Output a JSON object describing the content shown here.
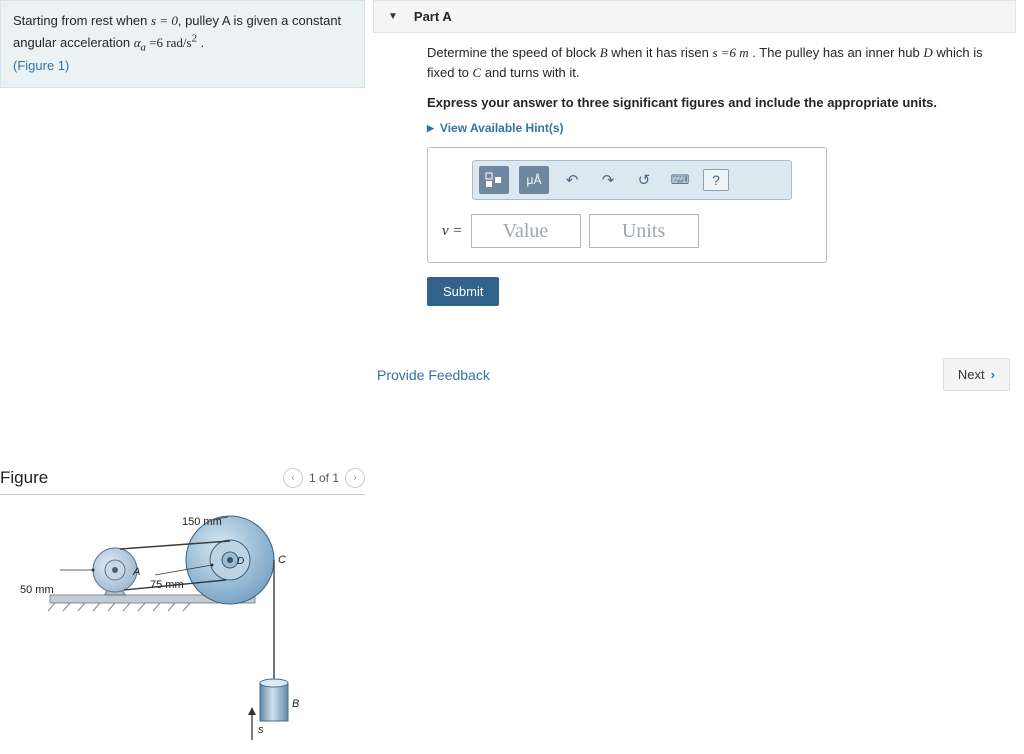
{
  "problem": {
    "text_prefix": "Starting from rest when ",
    "s_eq": "s = 0",
    "text_mid1": ", pulley A is given a constant angular acceleration ",
    "alpha_expr": "α",
    "alpha_sub": "a",
    "alpha_eq": " =6 rad/s",
    "alpha_sup": "2",
    "text_end": " .",
    "figure_link": "(Figure 1)"
  },
  "figure": {
    "heading": "Figure",
    "counter": "1 of 1",
    "labels": {
      "r_a": "50 mm",
      "A": "A",
      "r_d": "75 mm",
      "r_c": "150 mm",
      "D": "D",
      "C": "C",
      "B": "B",
      "s": "s"
    }
  },
  "part": {
    "title": "Part A",
    "instruction_1": "Determine the speed of block ",
    "B_i": "B",
    "instruction_2": " when it has risen ",
    "s_val": "s =6 m",
    "instruction_3": " . The pulley has an inner hub ",
    "D_i": "D",
    "instruction_4": " which is fixed to ",
    "C_i": "C",
    "instruction_5": " and turns with it.",
    "prompt": "Express your answer to three significant figures and include the appropriate units.",
    "hints": "View Available Hint(s)",
    "toolbar": {
      "units_btn": "μÅ",
      "help": "?"
    },
    "answer": {
      "label": "v =",
      "value_ph": "Value",
      "units_ph": "Units"
    },
    "submit": "Submit"
  },
  "footer": {
    "feedback": "Provide Feedback",
    "next": "Next"
  }
}
